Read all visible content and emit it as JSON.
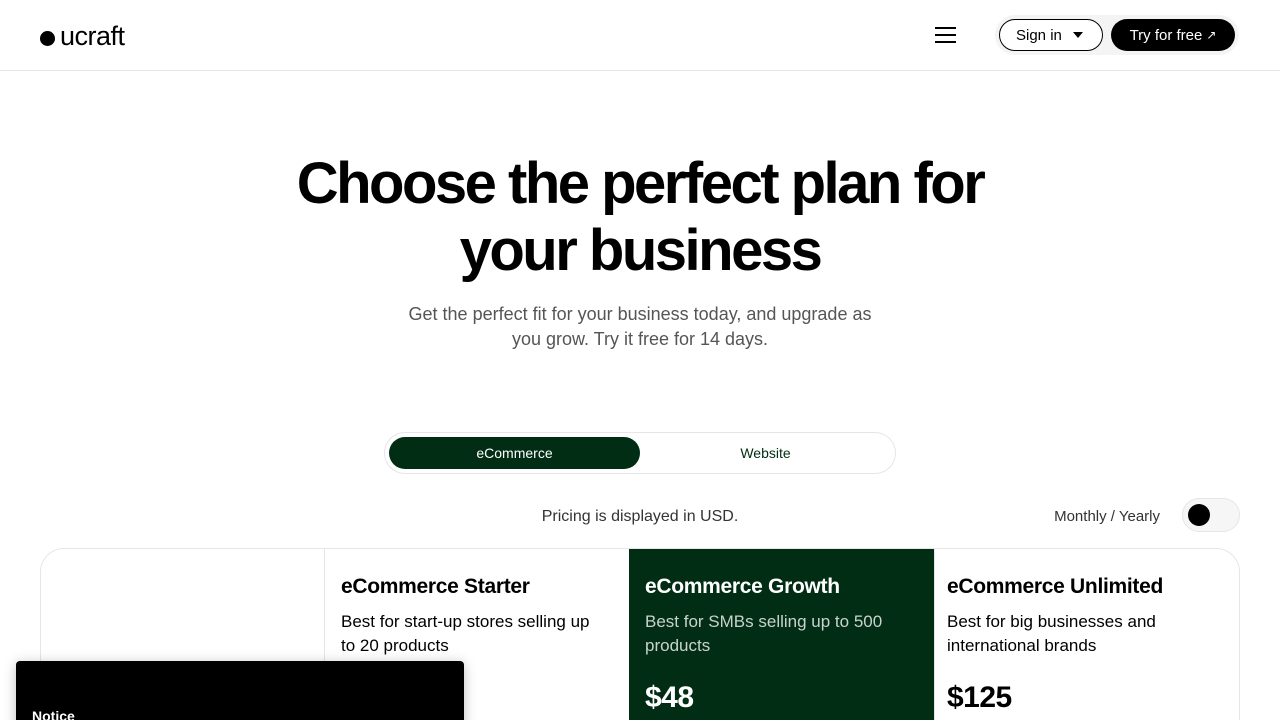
{
  "header": {
    "logo_text": "ucraft",
    "signin_label": "Sign in",
    "try_label": "Try for free",
    "try_arrow": "↗"
  },
  "hero": {
    "title": "Choose the perfect plan for your business",
    "subtitle": "Get the perfect fit for your business today, and upgrade as you grow. Try it free for 14 days."
  },
  "tabs": [
    {
      "label": "eCommerce",
      "active": true
    },
    {
      "label": "Website",
      "active": false
    }
  ],
  "pricing_note": "Pricing is displayed in USD.",
  "billing": {
    "label": "Monthly / Yearly",
    "yearly": false
  },
  "plans": [
    {
      "name": "eCommerce Starter",
      "description": "Best for start-up stores selling up to 20 products",
      "price": ""
    },
    {
      "name": "eCommerce Growth",
      "description": "Best for SMBs selling up to 500 products",
      "price": "$48"
    },
    {
      "name": "eCommerce Unlimited",
      "description": "Best for big businesses and international brands",
      "price": "$125"
    }
  ],
  "notice": {
    "title": "Notice"
  },
  "colors": {
    "brand_dark_green": "#002d14",
    "black": "#000000",
    "border": "#e6e6e6"
  }
}
